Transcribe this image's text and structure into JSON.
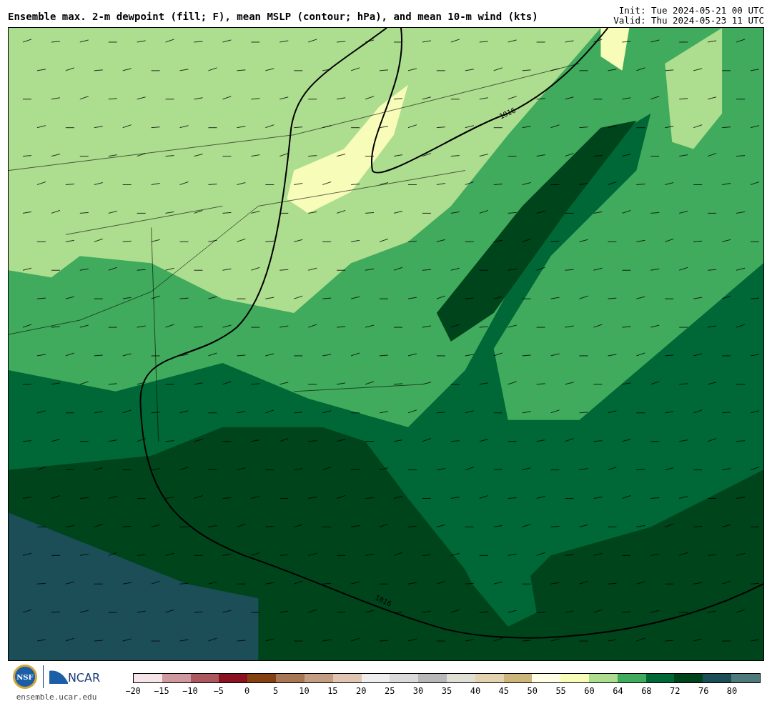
{
  "header": {
    "title": "Ensemble max. 2-m dewpoint (fill; F), mean MSLP (contour; hPa), and mean 10-m wind (kts)",
    "init": "Init: Tue 2024-05-21 00 UTC",
    "valid": "Valid: Thu 2024-05-23 11 UTC"
  },
  "map": {
    "contour_labels": [
      "1016",
      "1016"
    ]
  },
  "colorbar": {
    "bins": [
      {
        "color": "#f5e5e8"
      },
      {
        "color": "#d0989f"
      },
      {
        "color": "#ad575f"
      },
      {
        "color": "#8b1220"
      },
      {
        "color": "#854112"
      },
      {
        "color": "#a87856"
      },
      {
        "color": "#c49e82"
      },
      {
        "color": "#e0c6b2"
      },
      {
        "color": "#eeeeee"
      },
      {
        "color": "#dadada"
      },
      {
        "color": "#b8b8b8"
      },
      {
        "color": "#dfe0d3"
      },
      {
        "color": "#e3d2ae"
      },
      {
        "color": "#cdb67a"
      },
      {
        "color": "#ffffe5"
      },
      {
        "color": "#f7fcb9"
      },
      {
        "color": "#addd8e"
      },
      {
        "color": "#41ab5d"
      },
      {
        "color": "#006837"
      },
      {
        "color": "#00441b"
      },
      {
        "color": "#1b4e57"
      },
      {
        "color": "#4f7a7c"
      }
    ],
    "tick_labels": [
      "−20",
      "−15",
      "−10",
      "−5",
      "0",
      "5",
      "10",
      "15",
      "20",
      "25",
      "30",
      "35",
      "40",
      "45",
      "50",
      "55",
      "60",
      "64",
      "68",
      "72",
      "76",
      "80"
    ]
  },
  "footer": {
    "nsf_logo_text": "NSF",
    "ncar_logo_text": "NCAR",
    "site": "ensemble.ucar.edu"
  }
}
